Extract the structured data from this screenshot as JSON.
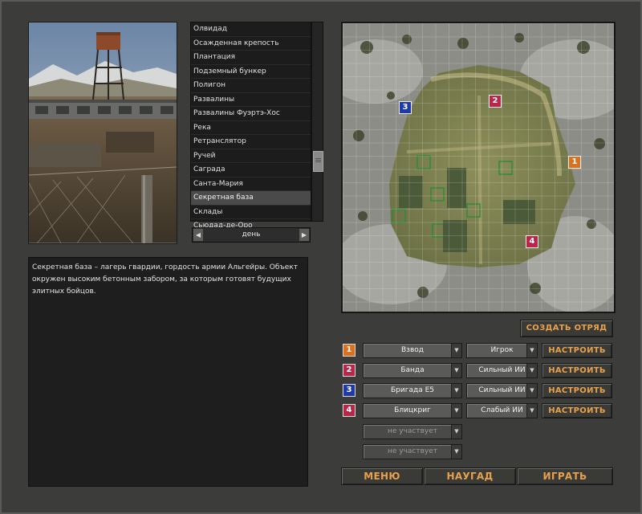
{
  "maps": [
    "Олвидад",
    "Осажденная крепость",
    "Плантация",
    "Подземный бункер",
    "Полигон",
    "Развалины",
    "Развалины Фуэртэ-Хос",
    "Река",
    "Ретранслятор",
    "Ручей",
    "Саграда",
    "Санта-Мария",
    "Секретная база",
    "Склады",
    "Сьюдад-де-Оро"
  ],
  "selected_map_index": 12,
  "time_of_day": "день",
  "description": "Секретная база – лагерь гвардии, гордость армии Альгейры. Объект окружен высоким бетонным забором, за которым готовят будущих элитных бойцов.",
  "create_squad_label": "СОЗДАТЬ ОТРЯД",
  "players": [
    {
      "num": "1",
      "color": "#d9711e",
      "team": "Взвод",
      "control": "Игрок",
      "button": "НАСТРОИТЬ"
    },
    {
      "num": "2",
      "color": "#b8274a",
      "team": "Банда",
      "control": "Сильный ИИ",
      "button": "НАСТРОИТЬ"
    },
    {
      "num": "3",
      "color": "#1f3aa8",
      "team": "Бригада Е5",
      "control": "Сильный ИИ",
      "button": "НАСТРОИТЬ"
    },
    {
      "num": "4",
      "color": "#b8274a",
      "team": "Блицкриг",
      "control": "Слабый ИИ",
      "button": "НАСТРОИТЬ"
    }
  ],
  "inactive_slots": [
    "не участвует",
    "не участвует"
  ],
  "map_markers": [
    {
      "num": "1",
      "color": "#d9711e"
    },
    {
      "num": "2",
      "color": "#b8274a"
    },
    {
      "num": "3",
      "color": "#1f3aa8"
    },
    {
      "num": "4",
      "color": "#b8274a"
    }
  ],
  "bottom": {
    "menu": "МЕНЮ",
    "random": "НАУГАД",
    "play": "ИГРАТЬ"
  },
  "icons": {
    "scroll_left": "triangle-left-icon",
    "scroll_right": "triangle-right-icon",
    "dropdown": "triangle-down-icon"
  }
}
